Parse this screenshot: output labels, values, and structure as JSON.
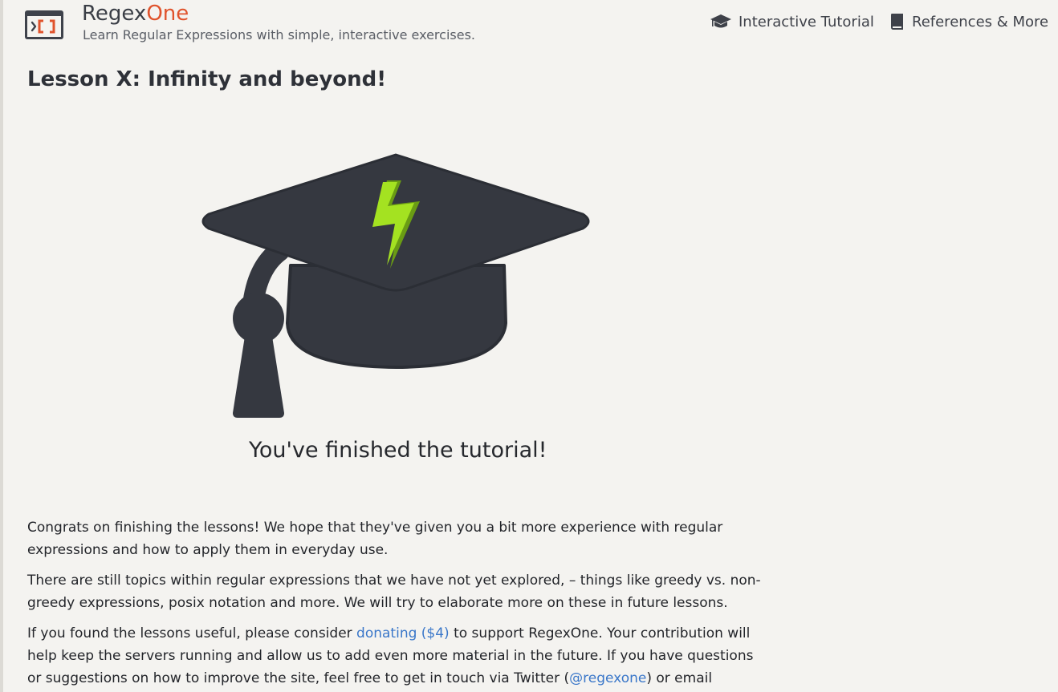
{
  "header": {
    "brand_prefix": "Regex",
    "brand_suffix": "One",
    "tagline": "Learn Regular Expressions with simple, interactive exercises.",
    "logo_glyph": "›[]",
    "nav": {
      "tutorial_label": "Interactive Tutorial",
      "references_label": "References & More"
    }
  },
  "lesson": {
    "title": "Lesson X: Infinity and beyond!",
    "finished_message": "You've finished the tutorial!",
    "paragraphs": {
      "p1": "Congrats on finishing the lessons! We hope that they've given you a bit more experience with regular expressions and how to apply them in everyday use.",
      "p2": "There are still topics within regular expressions that we have not yet explored, – things like greedy vs. non-greedy expressions, posix notation and more. We will try to elaborate more on these in future lessons.",
      "p3": {
        "before_donate": "If you found the lessons useful, please consider ",
        "donate_link": "donating ($4)",
        "after_donate": " to support RegexOne. Your contribution will help keep the servers running and allow us to add even more material in the future. If you have questions or suggestions on how to improve the site, feel free to get in touch via Twitter (",
        "twitter_link": "@regexone",
        "after_twitter": ") or email"
      }
    }
  },
  "colors": {
    "background": "#f4f3f0",
    "brand_accent": "#e0532c",
    "cap_dark": "#353840",
    "bolt_green": "#a4e221",
    "link": "#3a77c9"
  },
  "icons": {
    "logo": "regexone-logo-icon",
    "tutorial": "graduation-cap-icon",
    "references": "book-icon",
    "hero": "graduation-cap-lightning-illustration"
  }
}
